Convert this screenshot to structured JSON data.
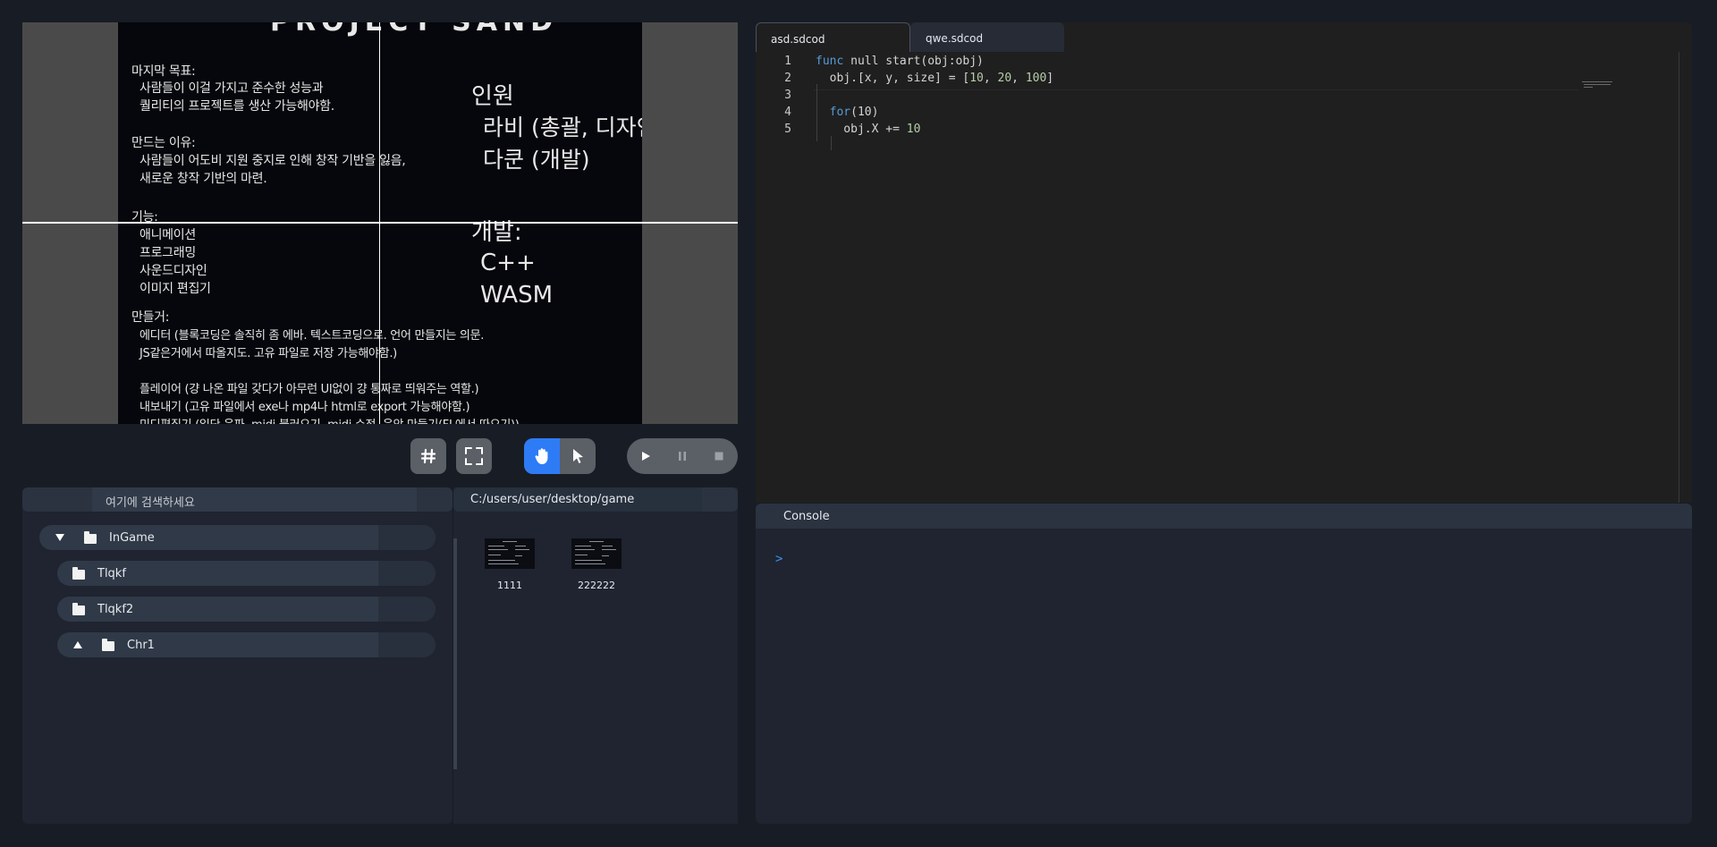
{
  "preview": {
    "slide": {
      "title": "PROJECT SAND",
      "goal_title": "마지막 목표:",
      "goal_1": "사람들이 이걸 가지고 준수한 성능과",
      "goal_2": "퀄리티의 프로젝트를 생산 가능해야함.",
      "why_title": "만드는 이유:",
      "why_1": "사람들이 어도비 지원 중지로 인해 창작 기반을 잃음,",
      "why_2": "새로운 창작 기반의 마련.",
      "feat_title": "기능:",
      "feat_1": "애니메이션",
      "feat_2": "프로그래밍",
      "feat_3": "사운드디자인",
      "feat_4": "이미지 편집기",
      "make_title": "만들거:",
      "make_1": "에디터 (블록코딩은 솔직히 좀 에바. 텍스트코딩으로. 언어 만들지는 의문.",
      "make_2": "JS같은거에서 따올지도. 고유 파일로 저장 가능해야함.)",
      "make_3": "플레이어 (걍 나온 파일 갖다가 아무런 UI없이 걍 통짜로 띄워주는 역할.)",
      "make_4": "내보내기 (고유 파일에서 exe나 mp4나 html로 export 가능해야함.)",
      "make_5": "미디편집기 (일단 음파, midi 불러오기, midi 수정, 음악 만들기(FL에서 따오기))",
      "staff_title": "인원",
      "staff_1": "라비 (총괄, 디자인)",
      "staff_2": "다쿤 (개발)",
      "dev_title": "개발:",
      "dev_1": "C++",
      "dev_2": "WASM"
    }
  },
  "toolbar": {
    "grid_icon": "grid-hash-icon",
    "fullscreen_icon": "fullscreen-icon",
    "hand_icon": "hand-icon",
    "pointer_icon": "pointer-arrow-icon",
    "play_icon": "play-icon",
    "pause_icon": "pause-icon",
    "stop_icon": "stop-icon",
    "active_tool": "hand",
    "accent": "#2e7bf6"
  },
  "hierarchy": {
    "search_placeholder": "여기에 검색하세요",
    "items": [
      {
        "label": "InGame",
        "expanded": true
      },
      {
        "label": "Tlqkf"
      },
      {
        "label": "Tlqkf2"
      },
      {
        "label": "Chr1",
        "expanded": false
      }
    ]
  },
  "files": {
    "path": "C:/users/user/desktop/game",
    "items": [
      {
        "label": "1111"
      },
      {
        "label": "222222"
      }
    ]
  },
  "editor": {
    "tabs": [
      {
        "label": "asd.sdcod",
        "active": true
      },
      {
        "label": "qwe.sdcod",
        "active": false
      }
    ],
    "line_numbers": [
      "1",
      "2",
      "3",
      "4",
      "5"
    ],
    "code": {
      "l1_kw": "func",
      "l1_rest": " null start(obj:obj)",
      "l2_a": "  obj.[x, y, size] = [",
      "l2_n1": "10",
      "l2_c1": ", ",
      "l2_n2": "20",
      "l2_c2": ", ",
      "l2_n3": "100",
      "l2_b": "]",
      "l4_a": "  ",
      "l4_kw": "for",
      "l4_rest": "(10)",
      "l5_a": "    obj.X += ",
      "l5_n": "10"
    }
  },
  "console": {
    "tab_label": "Console",
    "prompt": ">"
  }
}
